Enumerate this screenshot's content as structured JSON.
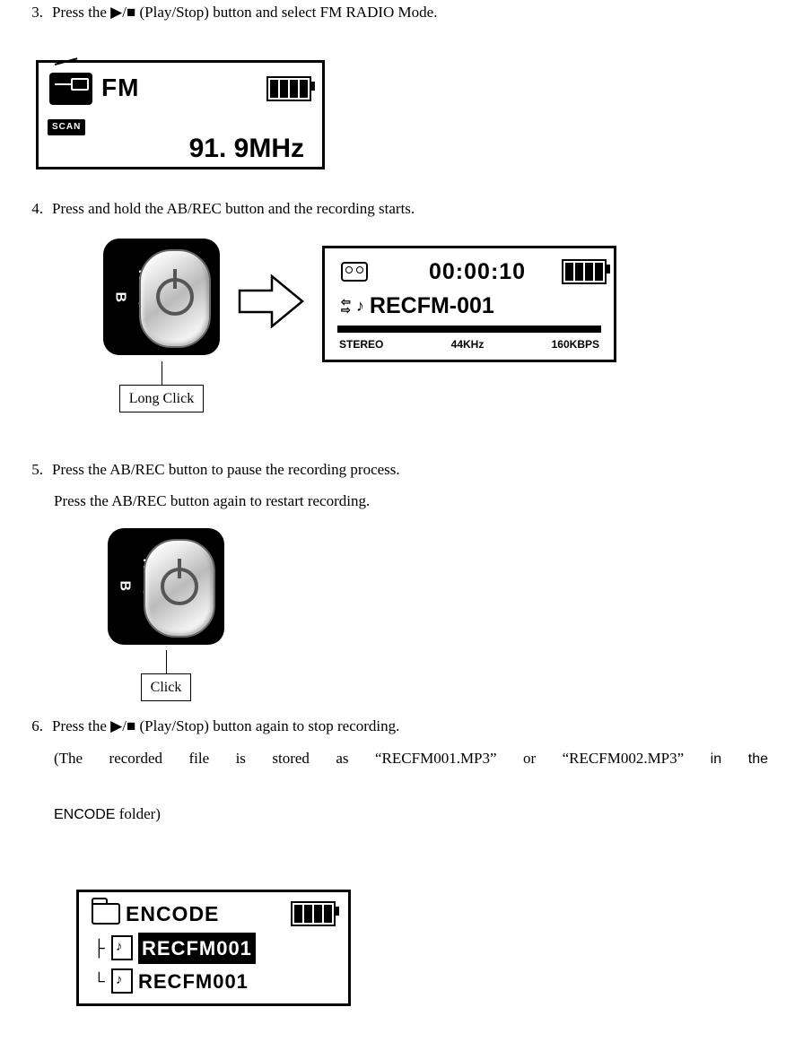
{
  "step3": {
    "num": "3.",
    "text_a": "Press the ",
    "btn": "▶/■",
    "text_b": " (Play/Stop) button and select FM RADIO Mode."
  },
  "fm_screen": {
    "mode": "FM",
    "scan": "SCAN",
    "freq": "91. 9MHz"
  },
  "step4": {
    "num": "4.",
    "text": "Press and hold the AB/REC button and the recording starts."
  },
  "button_side_label": "REC/A-B",
  "long_click_label": "Long Click",
  "click_label": "Click",
  "rec_screen": {
    "timer": "00:00:10",
    "name": "RECFM-001",
    "stereo": "STEREO",
    "khz": "44KHz",
    "kbps": "160KBPS"
  },
  "step5": {
    "num": "5.",
    "line1": "Press the AB/REC button to pause the recording process.",
    "line2": "Press the AB/REC button again to restart recording."
  },
  "step6": {
    "num": "6.",
    "line1_a": "Press the ",
    "line1_btn": "▶/■",
    "line1_b": " (Play/Stop) button again to stop recording.",
    "line2_a": "(The recorded file is stored as “RECFM001.MP3” or “RECFM002.MP3”",
    "line2_in_the": "in the",
    "line3_encode": "ENCODE",
    "line3_rest": " folder)"
  },
  "encode_screen": {
    "folder": "ENCODE",
    "file_selected": "RECFM001",
    "file_other": "RECFM001"
  }
}
